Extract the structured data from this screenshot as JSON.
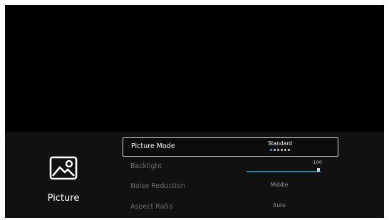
{
  "category": {
    "label": "Picture",
    "icon": "picture-icon"
  },
  "settings": [
    {
      "label": "Picture Mode",
      "value": "Standard",
      "selected": true,
      "option_count": 6,
      "active_option_index": 0
    },
    {
      "label": "Backlight",
      "value": "100",
      "level": 1.0
    },
    {
      "label": "Noise Reduction",
      "value": "Middle"
    },
    {
      "label": "Aspect Ratio",
      "value": "Auto"
    }
  ],
  "colors": {
    "panel": "#111111",
    "accent": "#24a8e0",
    "highlight_border": "#d7d7d7"
  }
}
